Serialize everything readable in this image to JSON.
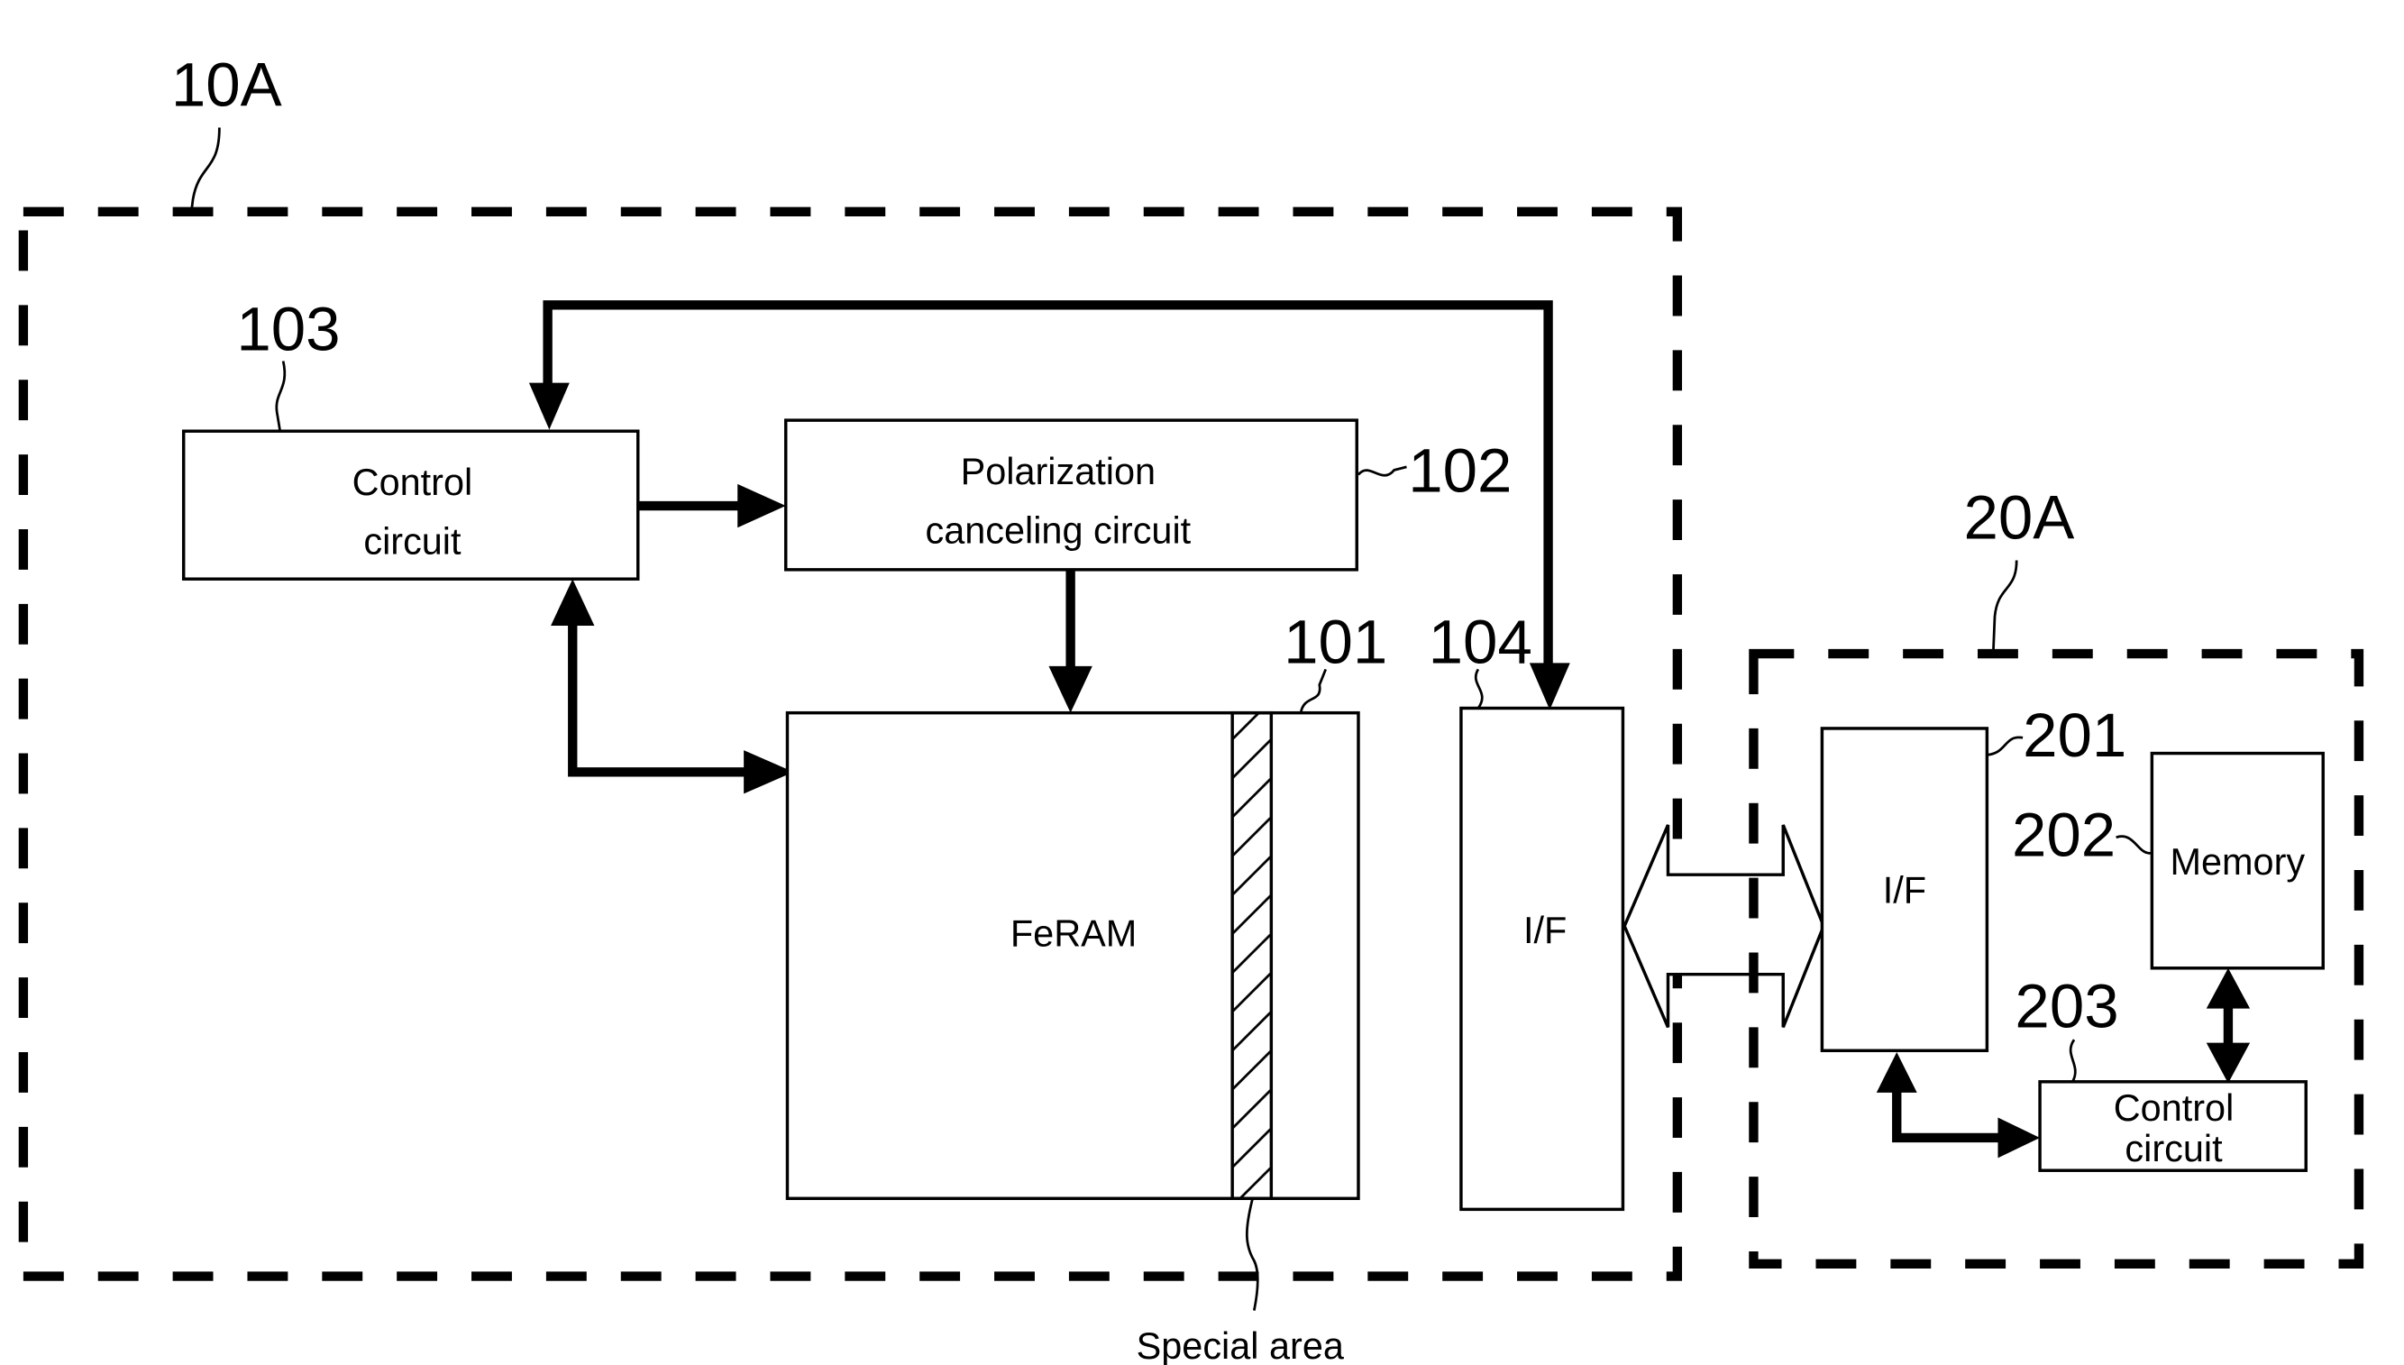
{
  "figure": {
    "groups": [
      {
        "id": "10A",
        "label": "10A"
      },
      {
        "id": "20A",
        "label": "20A"
      }
    ],
    "blocks": {
      "control_circuit_103": {
        "ref": "103",
        "lines": [
          "Control",
          "circuit"
        ]
      },
      "polarization_canceling_102": {
        "ref": "102",
        "lines": [
          "Polarization",
          "canceling circuit"
        ]
      },
      "feram_101": {
        "ref": "101",
        "lines": [
          "FeRAM"
        ]
      },
      "if_104": {
        "ref": "104",
        "lines": [
          "I/F"
        ]
      },
      "if_201": {
        "ref": "201",
        "lines": [
          "I/F"
        ]
      },
      "memory_202": {
        "ref": "202",
        "lines": [
          "Memory"
        ]
      },
      "control_circuit_203": {
        "ref": "203",
        "lines": [
          "Control",
          "circuit"
        ]
      }
    },
    "annotations": {
      "special_area": "Special area"
    },
    "connections": [
      {
        "from": "103",
        "to": "102",
        "direction": "one-way"
      },
      {
        "from": "102",
        "to": "101",
        "direction": "one-way"
      },
      {
        "from": "103",
        "to": "101",
        "direction": "two-way"
      },
      {
        "from": "104",
        "to": "103",
        "direction": "two-way"
      },
      {
        "from": "104",
        "to": "201",
        "direction": "two-way-bus"
      },
      {
        "from": "201",
        "to": "203",
        "direction": "two-way"
      },
      {
        "from": "202",
        "to": "203",
        "direction": "two-way"
      }
    ]
  }
}
